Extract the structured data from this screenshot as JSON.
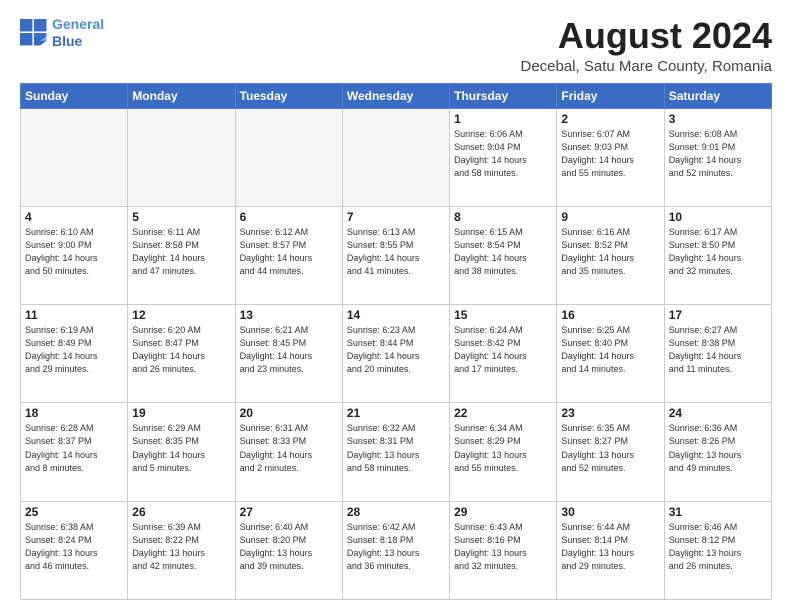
{
  "logo": {
    "line1": "General",
    "line2": "Blue"
  },
  "title": "August 2024",
  "subtitle": "Decebal, Satu Mare County, Romania",
  "days_of_week": [
    "Sunday",
    "Monday",
    "Tuesday",
    "Wednesday",
    "Thursday",
    "Friday",
    "Saturday"
  ],
  "weeks": [
    [
      {
        "day": "",
        "info": ""
      },
      {
        "day": "",
        "info": ""
      },
      {
        "day": "",
        "info": ""
      },
      {
        "day": "",
        "info": ""
      },
      {
        "day": "1",
        "info": "Sunrise: 6:06 AM\nSunset: 9:04 PM\nDaylight: 14 hours\nand 58 minutes."
      },
      {
        "day": "2",
        "info": "Sunrise: 6:07 AM\nSunset: 9:03 PM\nDaylight: 14 hours\nand 55 minutes."
      },
      {
        "day": "3",
        "info": "Sunrise: 6:08 AM\nSunset: 9:01 PM\nDaylight: 14 hours\nand 52 minutes."
      }
    ],
    [
      {
        "day": "4",
        "info": "Sunrise: 6:10 AM\nSunset: 9:00 PM\nDaylight: 14 hours\nand 50 minutes."
      },
      {
        "day": "5",
        "info": "Sunrise: 6:11 AM\nSunset: 8:58 PM\nDaylight: 14 hours\nand 47 minutes."
      },
      {
        "day": "6",
        "info": "Sunrise: 6:12 AM\nSunset: 8:57 PM\nDaylight: 14 hours\nand 44 minutes."
      },
      {
        "day": "7",
        "info": "Sunrise: 6:13 AM\nSunset: 8:55 PM\nDaylight: 14 hours\nand 41 minutes."
      },
      {
        "day": "8",
        "info": "Sunrise: 6:15 AM\nSunset: 8:54 PM\nDaylight: 14 hours\nand 38 minutes."
      },
      {
        "day": "9",
        "info": "Sunrise: 6:16 AM\nSunset: 8:52 PM\nDaylight: 14 hours\nand 35 minutes."
      },
      {
        "day": "10",
        "info": "Sunrise: 6:17 AM\nSunset: 8:50 PM\nDaylight: 14 hours\nand 32 minutes."
      }
    ],
    [
      {
        "day": "11",
        "info": "Sunrise: 6:19 AM\nSunset: 8:49 PM\nDaylight: 14 hours\nand 29 minutes."
      },
      {
        "day": "12",
        "info": "Sunrise: 6:20 AM\nSunset: 8:47 PM\nDaylight: 14 hours\nand 26 minutes."
      },
      {
        "day": "13",
        "info": "Sunrise: 6:21 AM\nSunset: 8:45 PM\nDaylight: 14 hours\nand 23 minutes."
      },
      {
        "day": "14",
        "info": "Sunrise: 6:23 AM\nSunset: 8:44 PM\nDaylight: 14 hours\nand 20 minutes."
      },
      {
        "day": "15",
        "info": "Sunrise: 6:24 AM\nSunset: 8:42 PM\nDaylight: 14 hours\nand 17 minutes."
      },
      {
        "day": "16",
        "info": "Sunrise: 6:25 AM\nSunset: 8:40 PM\nDaylight: 14 hours\nand 14 minutes."
      },
      {
        "day": "17",
        "info": "Sunrise: 6:27 AM\nSunset: 8:38 PM\nDaylight: 14 hours\nand 11 minutes."
      }
    ],
    [
      {
        "day": "18",
        "info": "Sunrise: 6:28 AM\nSunset: 8:37 PM\nDaylight: 14 hours\nand 8 minutes."
      },
      {
        "day": "19",
        "info": "Sunrise: 6:29 AM\nSunset: 8:35 PM\nDaylight: 14 hours\nand 5 minutes."
      },
      {
        "day": "20",
        "info": "Sunrise: 6:31 AM\nSunset: 8:33 PM\nDaylight: 14 hours\nand 2 minutes."
      },
      {
        "day": "21",
        "info": "Sunrise: 6:32 AM\nSunset: 8:31 PM\nDaylight: 13 hours\nand 58 minutes."
      },
      {
        "day": "22",
        "info": "Sunrise: 6:34 AM\nSunset: 8:29 PM\nDaylight: 13 hours\nand 55 minutes."
      },
      {
        "day": "23",
        "info": "Sunrise: 6:35 AM\nSunset: 8:27 PM\nDaylight: 13 hours\nand 52 minutes."
      },
      {
        "day": "24",
        "info": "Sunrise: 6:36 AM\nSunset: 8:26 PM\nDaylight: 13 hours\nand 49 minutes."
      }
    ],
    [
      {
        "day": "25",
        "info": "Sunrise: 6:38 AM\nSunset: 8:24 PM\nDaylight: 13 hours\nand 46 minutes."
      },
      {
        "day": "26",
        "info": "Sunrise: 6:39 AM\nSunset: 8:22 PM\nDaylight: 13 hours\nand 42 minutes."
      },
      {
        "day": "27",
        "info": "Sunrise: 6:40 AM\nSunset: 8:20 PM\nDaylight: 13 hours\nand 39 minutes."
      },
      {
        "day": "28",
        "info": "Sunrise: 6:42 AM\nSunset: 8:18 PM\nDaylight: 13 hours\nand 36 minutes."
      },
      {
        "day": "29",
        "info": "Sunrise: 6:43 AM\nSunset: 8:16 PM\nDaylight: 13 hours\nand 32 minutes."
      },
      {
        "day": "30",
        "info": "Sunrise: 6:44 AM\nSunset: 8:14 PM\nDaylight: 13 hours\nand 29 minutes."
      },
      {
        "day": "31",
        "info": "Sunrise: 6:46 AM\nSunset: 8:12 PM\nDaylight: 13 hours\nand 26 minutes."
      }
    ]
  ]
}
